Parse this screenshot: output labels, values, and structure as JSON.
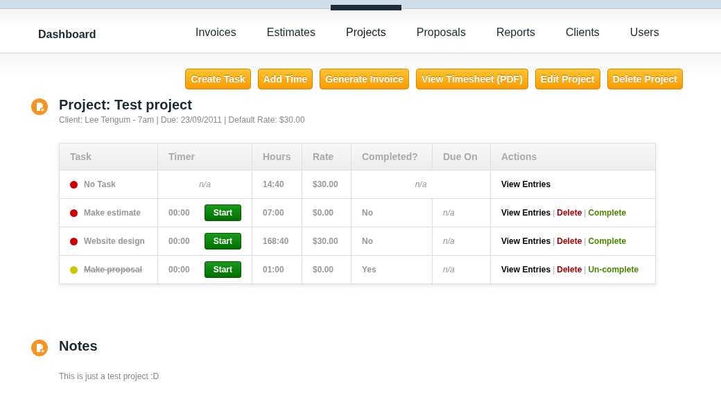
{
  "nav": {
    "brand": "Dashboard",
    "items": [
      {
        "label": "Invoices",
        "selected": false
      },
      {
        "label": "Estimates",
        "selected": false
      },
      {
        "label": "Projects",
        "selected": true
      },
      {
        "label": "Proposals",
        "selected": false
      },
      {
        "label": "Reports",
        "selected": false
      },
      {
        "label": "Clients",
        "selected": false
      },
      {
        "label": "Users",
        "selected": false
      }
    ]
  },
  "toolbar": [
    "Create Task",
    "Add Time",
    "Generate Invoice",
    "View Timesheet (PDF)",
    "Edit Project",
    "Delete Project"
  ],
  "project": {
    "title": "Project: Test project",
    "meta": "Client: Lee Tengum - 7am | Due: 23/09/2011 | Default Rate: $30.00"
  },
  "table": {
    "columns": [
      "Task",
      "Timer",
      "Hours",
      "Rate",
      "Completed?",
      "Due On",
      "Actions"
    ],
    "rows": [
      {
        "kind": "general",
        "color": "#cc0000",
        "task": "No Task",
        "completed": false,
        "timer": "n/a",
        "hours": "14:40",
        "rate": "$30.00",
        "completed_text": "n/a",
        "actions": [
          {
            "kind": "view",
            "label": "View Entries"
          }
        ]
      },
      {
        "kind": "task",
        "color": "#cc0000",
        "task": "Make estimate",
        "completed": false,
        "timer": "00:00",
        "start": "Start",
        "hours": "07:00",
        "rate": "$0.00",
        "completed_text": "No",
        "due": "n/a",
        "actions": [
          {
            "kind": "view",
            "label": "View Entries"
          },
          {
            "kind": "separator",
            "label": "|"
          },
          {
            "kind": "delete",
            "label": "Delete"
          },
          {
            "kind": "separator",
            "label": "|"
          },
          {
            "kind": "complete",
            "label": "Complete"
          }
        ]
      },
      {
        "kind": "task",
        "color": "#cc0000",
        "task": "Website design",
        "completed": false,
        "timer": "00:00",
        "start": "Start",
        "hours": "168:40",
        "rate": "$30.00",
        "completed_text": "No",
        "due": "n/a",
        "actions": [
          {
            "kind": "view",
            "label": "View Entries"
          },
          {
            "kind": "separator",
            "label": "|"
          },
          {
            "kind": "delete",
            "label": "Delete"
          },
          {
            "kind": "separator",
            "label": "|"
          },
          {
            "kind": "complete",
            "label": "Complete"
          }
        ]
      },
      {
        "kind": "task",
        "color": "#c8c800",
        "task": "Make proposal",
        "completed": true,
        "timer": "00:00",
        "start": "Start",
        "hours": "01:00",
        "rate": "$0.00",
        "completed_text": "Yes",
        "due": "n/a",
        "actions": [
          {
            "kind": "view",
            "label": "View Entries"
          },
          {
            "kind": "separator",
            "label": "|"
          },
          {
            "kind": "delete",
            "label": "Delete"
          },
          {
            "kind": "separator",
            "label": "|"
          },
          {
            "kind": "complete",
            "label": "Un-complete"
          }
        ]
      }
    ]
  },
  "notes": {
    "title": "Notes",
    "text": "This is just a test project :D"
  }
}
